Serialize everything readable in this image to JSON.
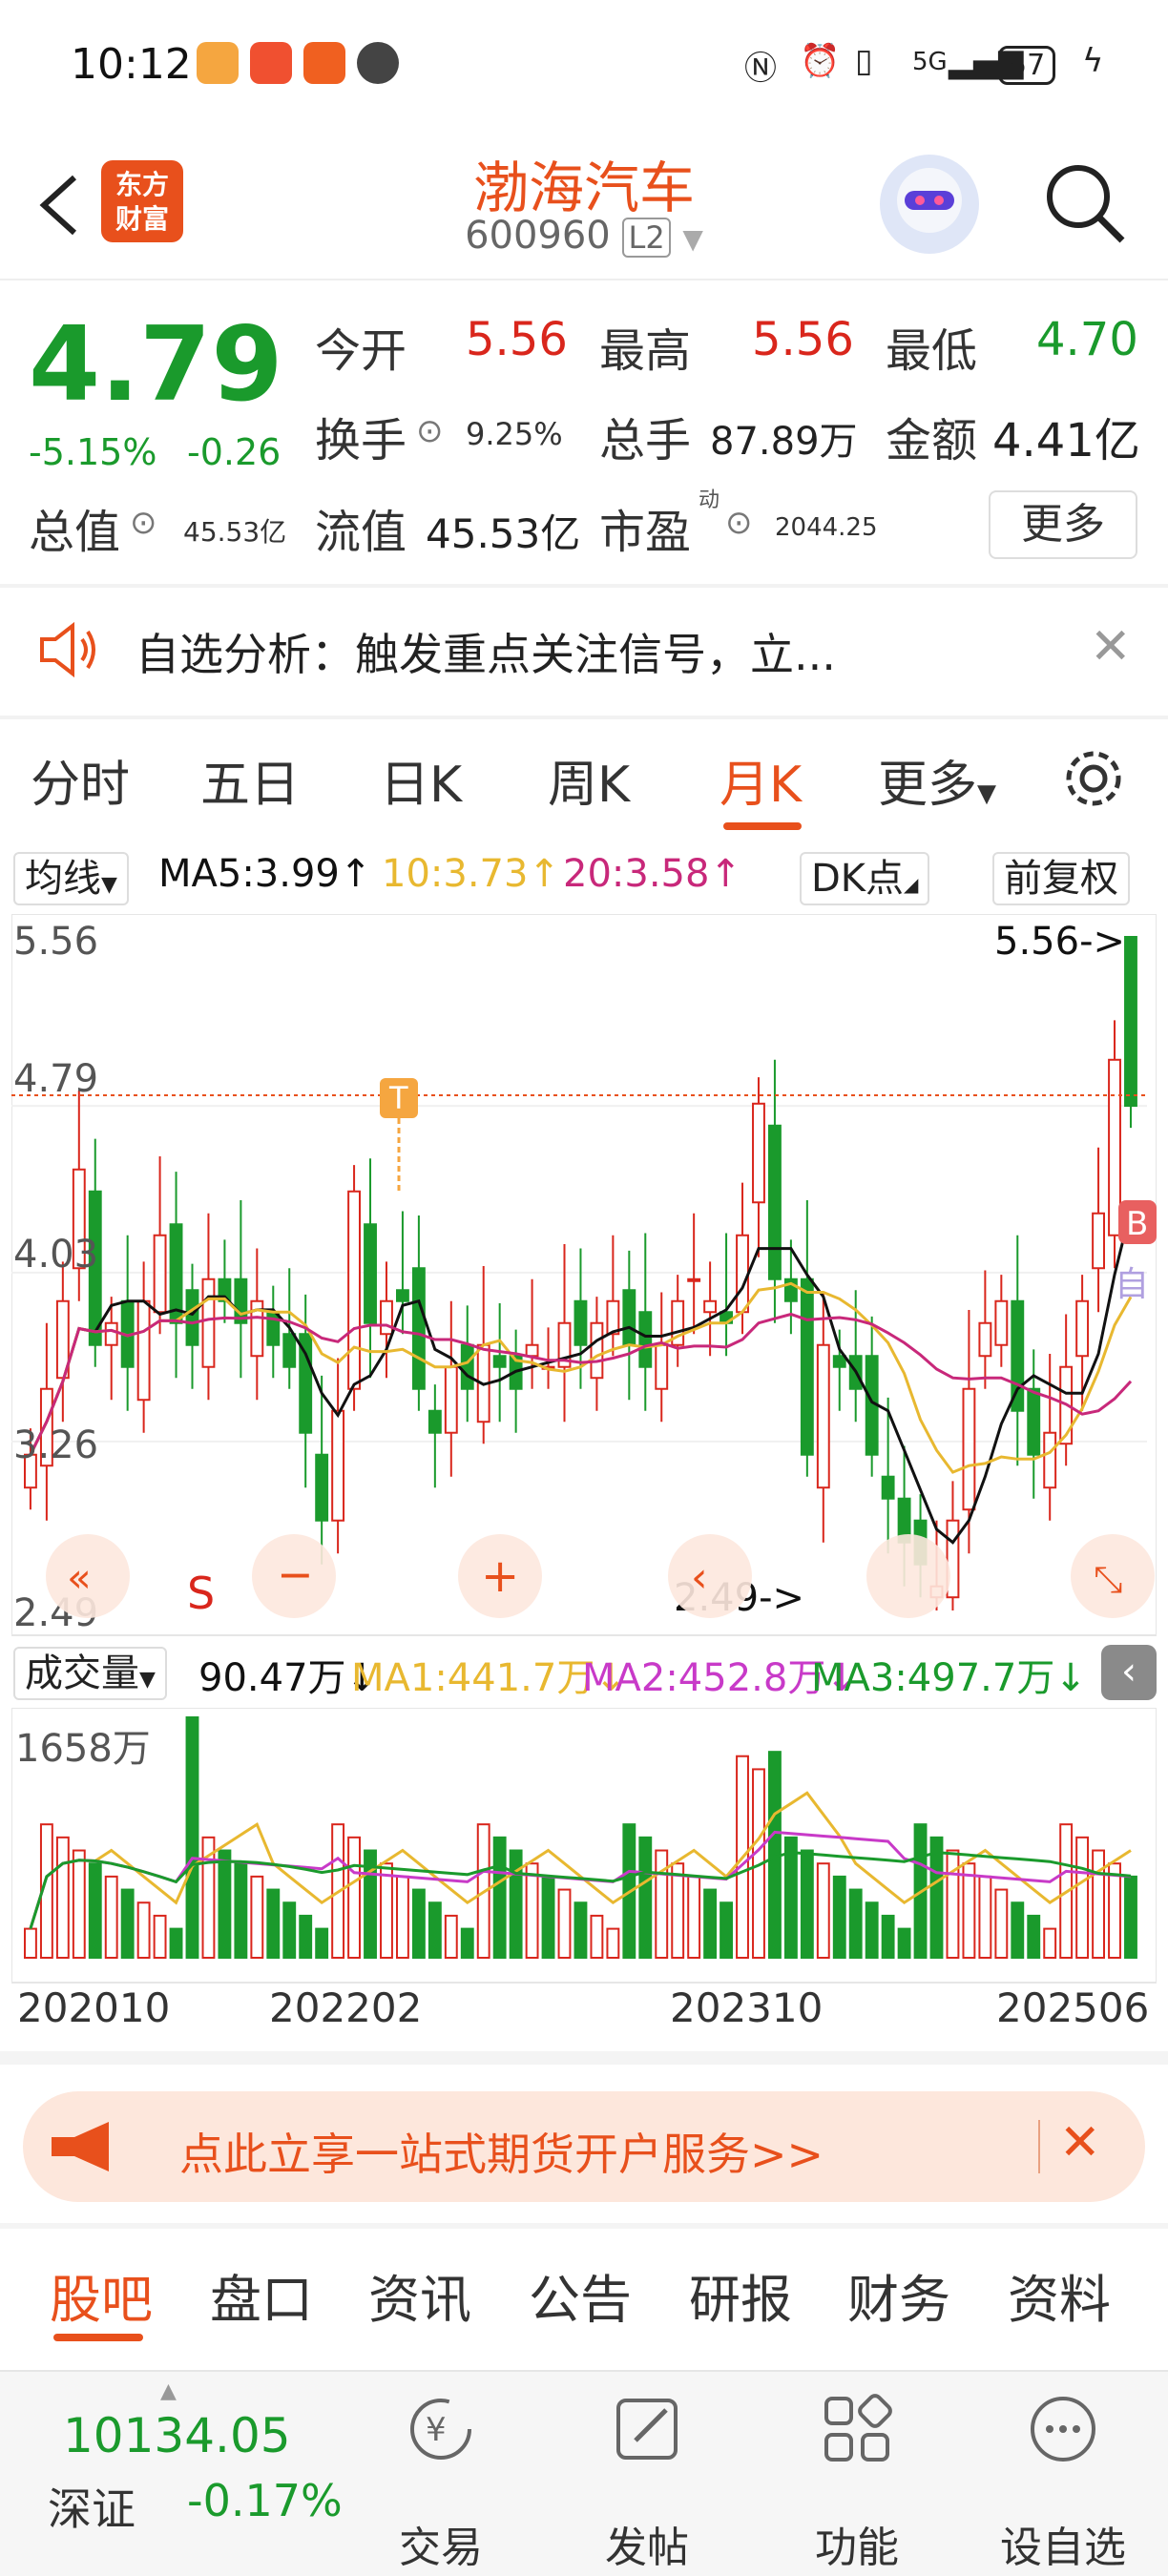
{
  "status_bar": {
    "time": "10:12",
    "battery": "57",
    "network": "5G"
  },
  "header": {
    "logo_line1": "东方",
    "logo_line2": "财富",
    "stock_name": "渤海汽车",
    "stock_code": "600960",
    "level": "L2"
  },
  "quote": {
    "price": "4.79",
    "change_pct": "-5.15%",
    "change": "-0.26",
    "fields": {
      "open_label": "今开",
      "open": "5.56",
      "high_label": "最高",
      "high": "5.56",
      "low_label": "最低",
      "low": "4.70",
      "turnover_label": "换手",
      "turnover": "9.25%",
      "volume_label": "总手",
      "volume": "87.89万",
      "amount_label": "金额",
      "amount": "4.41亿",
      "mktcap_label": "总值",
      "mktcap": "45.53亿",
      "float_label": "流值",
      "float": "45.53亿",
      "pe_label": "市盈",
      "pe_sup": "动",
      "pe": "2044.25"
    },
    "more_label": "更多"
  },
  "notice": {
    "text": "自选分析：触发重点关注信号，立..."
  },
  "period_tabs": {
    "items": [
      "分时",
      "五日",
      "日K",
      "周K",
      "月K"
    ],
    "more": "更多",
    "active": "月K"
  },
  "ma_row": {
    "selector": "均线",
    "ma5": "MA5:3.99↑",
    "ma10": "10:3.73↑",
    "ma20": "20:3.58↑",
    "dk": "DK点",
    "adjust": "前复权"
  },
  "chart_labels": {
    "y_max": "5.56",
    "y_mid1": "4.79",
    "y_mid2": "4.03",
    "y_mid3": "3.26",
    "y_min": "2.49",
    "max_marker": "5.56->",
    "min_marker": "2.49->",
    "t_marker": "T",
    "b_marker": "B",
    "s_marker": "S",
    "self_marker": "自"
  },
  "volume_row": {
    "selector": "成交量",
    "vol": "90.47万↓",
    "ma1": "MA1:441.7万↓",
    "ma2": "MA2:452.8万↓",
    "ma3": "MA3:497.7万↓",
    "y_max": "1658万"
  },
  "x_axis": [
    "202010",
    "202202",
    "202310",
    "202506"
  ],
  "banner": {
    "text": "点此立享一站式期货开户服务>>"
  },
  "sub_tabs": {
    "items": [
      "股吧",
      "盘口",
      "资讯",
      "公告",
      "研报",
      "财务",
      "资料"
    ],
    "active": "股吧"
  },
  "bottom_nav": {
    "index_value": "10134.05",
    "index_name": "深证",
    "index_change": "-0.17%",
    "trade": "交易",
    "post": "发帖",
    "function": "功能",
    "watchlist": "设自选"
  },
  "colors": {
    "accent": "#e8501c",
    "up": "#d9261c",
    "down": "#1a9a2c",
    "ma5": "#111111",
    "ma10": "#e8b830",
    "ma20": "#c8287a"
  },
  "chart_data": {
    "type": "candlestick",
    "period": "monthly",
    "ylim": [
      2.49,
      5.56
    ],
    "ma": {
      "MA5": 3.99,
      "MA10": 3.73,
      "MA20": 3.58
    },
    "last": {
      "open": 5.56,
      "high": 5.56,
      "low": 4.7,
      "close": 4.79
    }
  }
}
